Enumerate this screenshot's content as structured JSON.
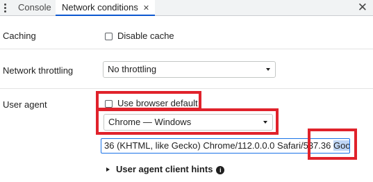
{
  "tabs": {
    "console": "Console",
    "network_conditions": "Network conditions",
    "tab_close_glyph": "✕",
    "panel_close_glyph": "✕"
  },
  "caching": {
    "label": "Caching",
    "disable_cache_label": "Disable cache",
    "disable_cache_checked": false
  },
  "throttling": {
    "label": "Network throttling",
    "selected": "No throttling"
  },
  "user_agent": {
    "label": "User agent",
    "use_browser_default_label": "Use browser default",
    "use_browser_default_checked": false,
    "preset_selected": "Chrome — Windows",
    "input_value_visible": "36 (KHTML, like Gecko) Chrome/112.0.0.0 Safari/537.36 ",
    "input_value_selected": "Googlebot",
    "client_hints_label": "User agent client hints",
    "info_glyph": "i"
  },
  "colors": {
    "highlight": "#e0222b",
    "tab_accent": "#0b57d0",
    "focus_border": "#1a73e8",
    "selection": "#bfd6f5"
  }
}
